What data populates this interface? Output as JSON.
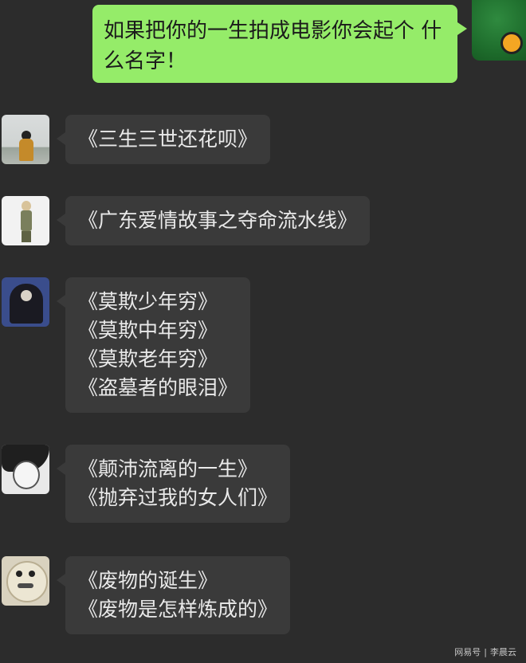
{
  "sent_message": {
    "lines": [
      "如果把你的一生拍成电影你会起个",
      "什么名字！"
    ]
  },
  "replies": [
    {
      "avatar_icon": "boy-back-view-avatar-icon",
      "lines": [
        "《三生三世还花呗》"
      ]
    },
    {
      "avatar_icon": "cartoon-boy-avatar-icon",
      "lines": [
        "《广东爱情故事之夺命流水线》"
      ]
    },
    {
      "avatar_icon": "anime-sitting-boy-avatar-icon",
      "lines": [
        "《莫欺少年穷》",
        "《莫欺中年穷》",
        "《莫欺老年穷》",
        "《盗墓者的眼泪》"
      ]
    },
    {
      "avatar_icon": "anime-sketch-face-avatar-icon",
      "lines": [
        "《颠沛流离的一生》",
        "《抛弃过我的女人们》"
      ]
    },
    {
      "avatar_icon": "meme-face-avatar-icon",
      "lines": [
        "《废物的诞生》",
        "《废物是怎样炼成的》"
      ]
    }
  ],
  "watermark": {
    "brand": "网易号",
    "separator": "|",
    "author": "李晨云"
  },
  "colors": {
    "background": "#2c2c2c",
    "sent_bubble": "#95ec69",
    "received_bubble": "#3a3a3a",
    "received_text": "#e9e9e9"
  }
}
